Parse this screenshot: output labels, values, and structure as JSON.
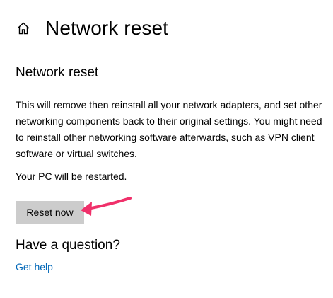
{
  "header": {
    "title": "Network reset",
    "home_icon": "home-icon"
  },
  "section": {
    "heading": "Network reset",
    "description": "This will remove then reinstall all your network adapters, and set other networking components back to their original settings. You might need to reinstall other networking software afterwards, such as VPN client software or virtual switches.",
    "restart_note": "Your PC will be restarted.",
    "reset_button_label": "Reset now"
  },
  "help": {
    "heading": "Have a question?",
    "link_label": "Get help"
  },
  "colors": {
    "link": "#0067b8",
    "button_bg": "#cccccc",
    "annotation_arrow": "#f0306a"
  }
}
